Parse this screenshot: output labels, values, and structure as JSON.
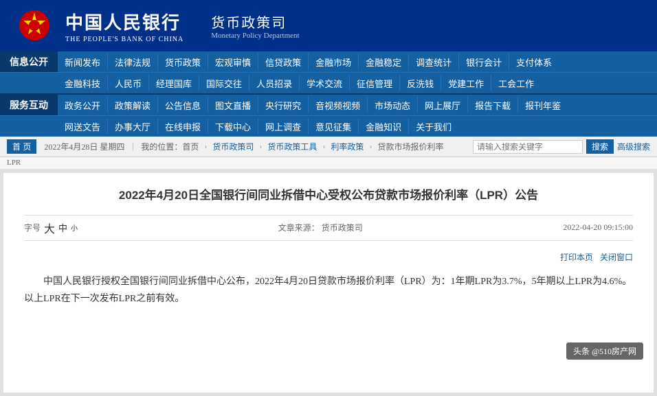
{
  "header": {
    "logo_chinese": "中国人民银行",
    "logo_english": "THE PEOPLE'S BANK OF CHINA",
    "dept_chinese": "货币政策司",
    "dept_english": "Monetary Policy Department"
  },
  "nav": {
    "info_label": "信息公开",
    "service_label": "服务互动",
    "row1": [
      "新闻发布",
      "法律法规",
      "货币政策",
      "宏观审慎",
      "信贷政策",
      "金融市场",
      "金融稳定",
      "调查统计",
      "银行会计",
      "支付体系"
    ],
    "row2": [
      "金融科技",
      "人民币",
      "经理国库",
      "国际交往",
      "人员招录",
      "学术交流",
      "征信管理",
      "反洗钱",
      "党建工作",
      "工会工作"
    ],
    "row3": [
      "政务公开",
      "政策解读",
      "公告信息",
      "图文直播",
      "央行研究",
      "音视频视频",
      "市场动态",
      "网上展厅",
      "报告下载",
      "报刊年鉴"
    ],
    "row4": [
      "网送文告",
      "办事大厅",
      "在线申报",
      "下载中心",
      "网上调查",
      "意见征集",
      "金融知识",
      "关于我们"
    ]
  },
  "breadcrumb": {
    "date": "2022年4月28日 星期四",
    "my_location": "我的位置：首页",
    "path": [
      "货币政策司",
      "货币政策工具",
      "利率政策",
      "贷款市场报价利率"
    ],
    "search_placeholder": "请输入搜索关键字",
    "search_btn": "搜索",
    "advanced": "高级搜索",
    "home_btn": "首 页",
    "lpr_label": "LPR"
  },
  "article": {
    "title": "2022年4月20日全国银行间同业拆借中心受权公布贷款市场报价利率（LPR）公告",
    "font_label": "字号",
    "font_large": "大",
    "font_medium": "中",
    "font_small": "小",
    "source_label": "文章来源：",
    "source": "货币政策司",
    "date": "2022-04-20  09:15:00",
    "print": "打印本页",
    "close": "关闭窗口",
    "body": "中国人民银行授权全国银行间同业拆借中心公布，2022年4月20日贷款市场报价利率（LPR）为：1年期LPR为3.7%，5年期以上LPR为4.6%。以上LPR在下一次发布LPR之前有效。"
  },
  "watermark": {
    "text": "头条 @510房产网"
  }
}
